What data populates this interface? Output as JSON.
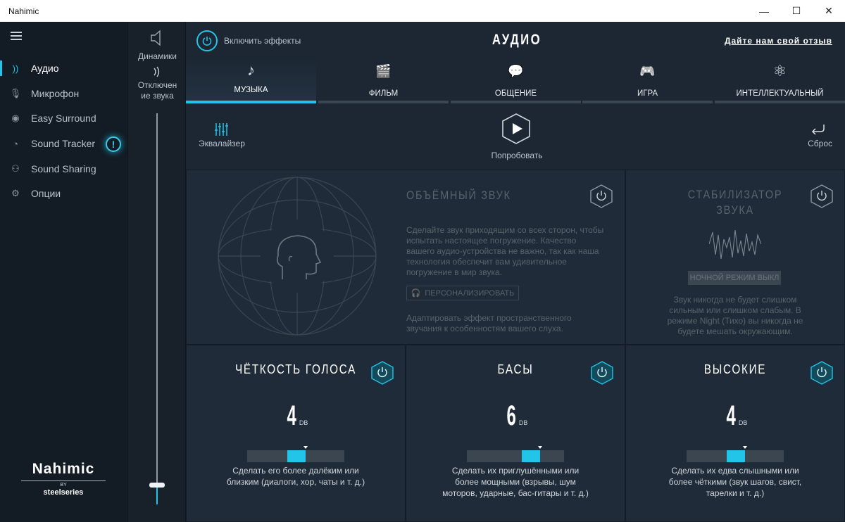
{
  "window": {
    "title": "Nahimic",
    "minimize": "—",
    "maximize": "☐",
    "close": "✕"
  },
  "sidebar": {
    "items": [
      {
        "label": "Аудио",
        "icon": "sound-waves-icon",
        "glyph": "))"
      },
      {
        "label": "Микрофон",
        "icon": "microphone-icon",
        "glyph": "🎙"
      },
      {
        "label": "Easy Surround",
        "icon": "surround-icon",
        "glyph": "◉"
      },
      {
        "label": "Sound Tracker",
        "icon": "tracker-icon",
        "glyph": "◔"
      },
      {
        "label": "Sound Sharing",
        "icon": "sharing-icon",
        "glyph": "⚇"
      },
      {
        "label": "Опции",
        "icon": "gear-icon",
        "glyph": "⚙"
      }
    ],
    "alert": "!",
    "logo": {
      "brand": "Nahimic",
      "by": "BY",
      "partner": "steelseries"
    }
  },
  "devices": {
    "speakers": "Динамики",
    "mute": "Отключение звука",
    "mute_line1": "Отключен",
    "mute_line2": "ие звука",
    "volume_fraction": 0.05
  },
  "header": {
    "effects_label": "Включить эффекты",
    "title": "АУДИО",
    "feedback": "Дайте нам свой отзыв"
  },
  "tabs": [
    {
      "label": "МУЗЫКА",
      "icon": "music-note-icon",
      "glyph": "♪"
    },
    {
      "label": "ФИЛЬМ",
      "icon": "clapperboard-icon",
      "glyph": "🎬"
    },
    {
      "label": "ОБЩЕНИЕ",
      "icon": "chat-bubbles-icon",
      "glyph": "💬"
    },
    {
      "label": "ИГРА",
      "icon": "gamepad-icon",
      "glyph": "🎮"
    },
    {
      "label": "ИНТЕЛЛЕКТУАЛЬНЫЙ",
      "icon": "atom-icon",
      "glyph": "⚛"
    }
  ],
  "tools": {
    "equalizer": "Эквалайзер",
    "try": "Попробовать",
    "reset": "Сброс"
  },
  "surround": {
    "title": "ОБЪЁМНЫЙ ЗВУК",
    "desc": [
      "Сделайте звук приходящим со всех сторон, чтобы",
      "испытать настоящее погружение. Качество",
      "вашего аудио-устройства не важно, так как наша",
      "технология обеспечит вам удивительное",
      "погружение в мир звука."
    ],
    "personalize": "ПЕРСОНАЛИЗИРОВАТЬ",
    "adapt": [
      "Адаптировать эффект пространственного",
      "звучания к особенностям вашего слуха."
    ]
  },
  "stabilizer": {
    "title_line1": "СТАБИЛИЗАТОР",
    "title_line2": "ЗВУКА",
    "night": "НОЧНОЙ РЕЖИМ ВЫКЛ",
    "desc": [
      "Звук никогда не будет слишком",
      "сильным или слишком слабым. В",
      "режиме Night (Тихо) вы никогда не",
      "будете мешать окружающим."
    ]
  },
  "bottom_panels": [
    {
      "title": "ЧЁТКОСТЬ ГОЛОСА",
      "value": "4",
      "unit": "DB",
      "level": 0.6,
      "desc": [
        "Сделать его более далёким или",
        "близким (диалоги, хор, чаты и т. д.)"
      ]
    },
    {
      "title": "БАСЫ",
      "value": "6",
      "unit": "DB",
      "level": 0.75,
      "desc": [
        "Сделать их приглушёнными или",
        "более мощными (взрывы, шум",
        "моторов, ударные, бас-гитары и т. д.)"
      ]
    },
    {
      "title": "ВЫСОКИЕ",
      "value": "4",
      "unit": "DB",
      "level": 0.6,
      "desc": [
        "Сделать их едва слышными или",
        "более чёткими (звук шагов, свист,",
        "тарелки и т. д.)"
      ]
    }
  ],
  "colors": {
    "accent": "#22c5e8",
    "background": "#1c2733",
    "sidebar": "#131b24"
  }
}
